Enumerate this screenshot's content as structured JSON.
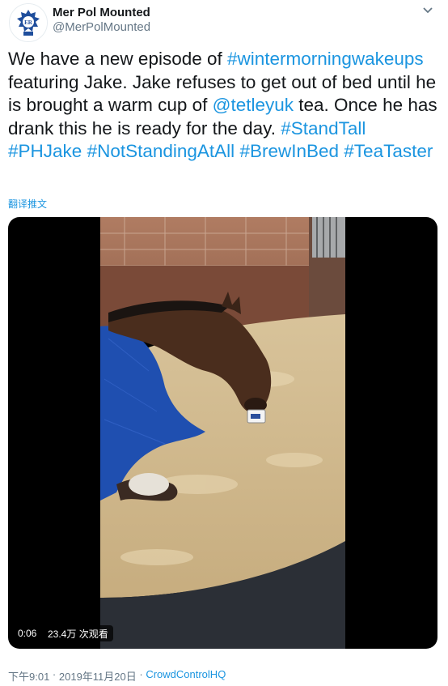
{
  "tweet": {
    "display_name": "Mer Pol Mounted",
    "handle": "@MerPolMounted",
    "avatar_icon": "police-crest-icon",
    "more_icon": "chevron-down-icon",
    "text": {
      "t1": "We have a new episode of ",
      "h1": "#wintermorningwakeups",
      "t2": " featuring Jake. Jake refuses to get out of bed until he is brought a warm cup of ",
      "m1": "@tetleyuk",
      "t3": " tea. Once he has drank this he is ready for the day. ",
      "h2": "#StandTall",
      "h3": "#PHJake",
      "h4": "#NotStandingAtAll",
      "h5": "#BrewInBed",
      "h6": "#TeaTaster"
    },
    "translate_label": "翻译推文",
    "video": {
      "duration": "0:06",
      "views": "23.4万 次观看"
    },
    "footer": {
      "time": "下午9:01",
      "separator": " · ",
      "date": "2019年11月20日",
      "source": "CrowdControlHQ"
    }
  },
  "colors": {
    "link": "#1b95e0",
    "text": "#14171a",
    "secondary": "#657786",
    "crest_blue": "#1f4e9c"
  }
}
